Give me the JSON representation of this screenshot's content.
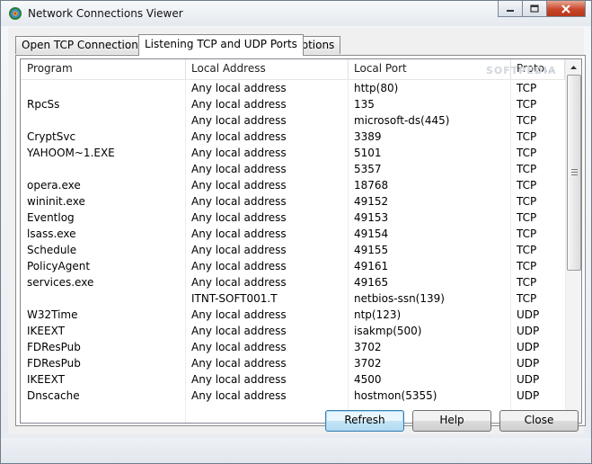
{
  "window": {
    "title": "Network Connections Viewer",
    "icon": "network-app-icon"
  },
  "tabs": [
    {
      "label": "Open TCP Connections",
      "active": false
    },
    {
      "label": "Listening TCP and UDP Ports",
      "active": true
    },
    {
      "label": "Options",
      "active": false
    }
  ],
  "columns": [
    "Program",
    "Local Address",
    "Local Port",
    "Proto..."
  ],
  "watermark": "SOFTPEDIA",
  "rows": [
    [
      "",
      "Any local address",
      "http(80)",
      "TCP"
    ],
    [
      "RpcSs",
      "Any local address",
      "135",
      "TCP"
    ],
    [
      "",
      "Any local address",
      "microsoft-ds(445)",
      "TCP"
    ],
    [
      "CryptSvc",
      "Any local address",
      "3389",
      "TCP"
    ],
    [
      "YAHOOM~1.EXE",
      "Any local address",
      "5101",
      "TCP"
    ],
    [
      "",
      "Any local address",
      "5357",
      "TCP"
    ],
    [
      "opera.exe",
      "Any local address",
      "18768",
      "TCP"
    ],
    [
      "wininit.exe",
      "Any local address",
      "49152",
      "TCP"
    ],
    [
      "Eventlog",
      "Any local address",
      "49153",
      "TCP"
    ],
    [
      "lsass.exe",
      "Any local address",
      "49154",
      "TCP"
    ],
    [
      "Schedule",
      "Any local address",
      "49155",
      "TCP"
    ],
    [
      "PolicyAgent",
      "Any local address",
      "49161",
      "TCP"
    ],
    [
      "services.exe",
      "Any local address",
      "49165",
      "TCP"
    ],
    [
      "",
      "ITNT-SOFT001.T",
      "netbios-ssn(139)",
      "TCP"
    ],
    [
      "W32Time",
      "Any local address",
      "ntp(123)",
      "UDP"
    ],
    [
      "IKEEXT",
      "Any local address",
      "isakmp(500)",
      "UDP"
    ],
    [
      "FDResPub",
      "Any local address",
      "3702",
      "UDP"
    ],
    [
      "FDResPub",
      "Any local address",
      "3702",
      "UDP"
    ],
    [
      "IKEEXT",
      "Any local address",
      "4500",
      "UDP"
    ],
    [
      "Dnscache",
      "Any local address",
      "hostmon(5355)",
      "UDP"
    ]
  ],
  "buttons": {
    "refresh": "Refresh",
    "help": "Help",
    "close": "Close"
  }
}
